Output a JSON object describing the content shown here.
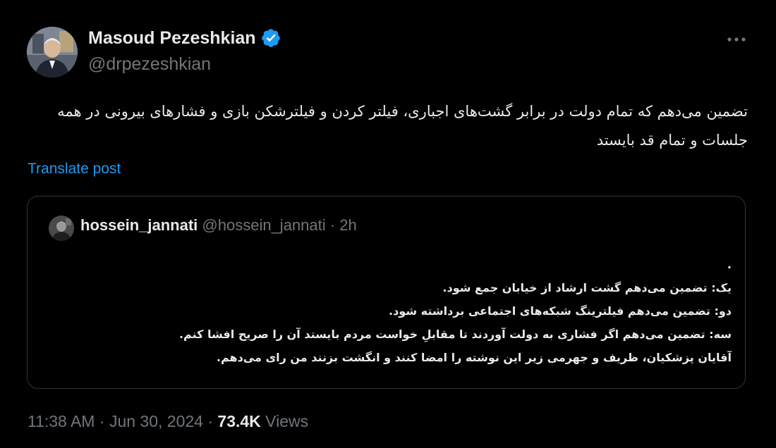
{
  "tweet": {
    "author": {
      "name": "Masoud Pezeshkian",
      "handle": "@drpezeshkian",
      "verified": true,
      "avatar_icon": "profile-photo"
    },
    "more_icon": "more-dots-icon",
    "body": "تضمین می‌دهم که تمام دولت در برابر  گشت‌های اجباری، فیلتر کردن و فیلترشکن بازی و فشارهای بیرونی در همه جلسات و تمام قد بایستد",
    "translate_label": "Translate post",
    "quote": {
      "name": "hossein_jannati",
      "handle": "@hossein_jannati",
      "separator": " · ",
      "time": "2h",
      "lines": [
        ".",
        "یک: تضمین می‌دهم گشت ارشاد از خیابان جمع شود.",
        "دو: تضمین می‌دهم فیلترینگ شبکه‌های اجتماعی برداشته شود.",
        "سه: تضمین می‌دهم اگر فشاری به دولت آوردند تا مقابلِ خواست مردم بایستد آن را صریح افشا کنم.",
        "آقایان پزشکیان، ظریف و جهرمی زیر این نوشته را امضا کنند و انگشت بزنند من رای می‌دهم."
      ]
    },
    "meta": {
      "time": "11:38 AM",
      "separator": " · ",
      "date": "Jun 30, 2024",
      "views_count": "73.4K",
      "views_label": "Views"
    },
    "colors": {
      "background": "#000000",
      "text": "#e7e9ea",
      "muted": "#71767b",
      "link": "#1d9bf0",
      "verified": "#1d9bf0",
      "border": "#2f3336"
    }
  }
}
